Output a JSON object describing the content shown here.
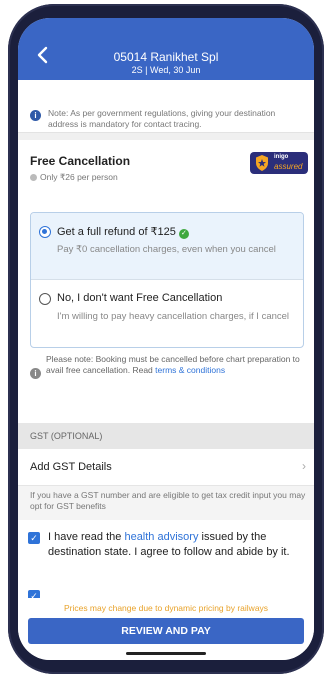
{
  "header": {
    "train_name": "05014 Ranikhet Spl",
    "trip_info": "2S | Wed, 30 Jun"
  },
  "notice": {
    "text": "Note: As per government regulations, giving your destination address is mandatory for contact tracing."
  },
  "free_cancellation": {
    "title": "Free Cancellation",
    "subtitle": "Only ₹26 per person",
    "badge_line1": "inigo",
    "badge_line2": "assured",
    "option_yes": {
      "label": "Get a full refund of ₹125",
      "desc": "Pay ₹0 cancellation charges, even when you cancel",
      "selected": true
    },
    "option_no": {
      "label": "No, I don't want Free Cancellation",
      "desc": "I'm willing to pay heavy cancellation charges, if I cancel",
      "selected": false
    },
    "note_prefix": "Please note: Booking must be cancelled before chart preparation to avail free cancellation. Read ",
    "note_link": "terms & conditions"
  },
  "gst": {
    "section_title": "GST (OPTIONAL)",
    "add_label": "Add GST Details",
    "info": "If you have a GST number and are eligible to get tax credit input you may opt for GST benefits"
  },
  "agreement": {
    "prefix": "I have read the ",
    "link": "health advisory",
    "suffix": " issued by the destination state. I agree to follow and abide by it.",
    "checked": true
  },
  "footer": {
    "price_note": "Prices may change due to dynamic pricing by railways",
    "pay_button": "REVIEW AND PAY"
  },
  "colors": {
    "primary": "#3a66c5",
    "accent": "#2f73d8",
    "warning": "#e8a22a",
    "success": "#3fa83f"
  }
}
